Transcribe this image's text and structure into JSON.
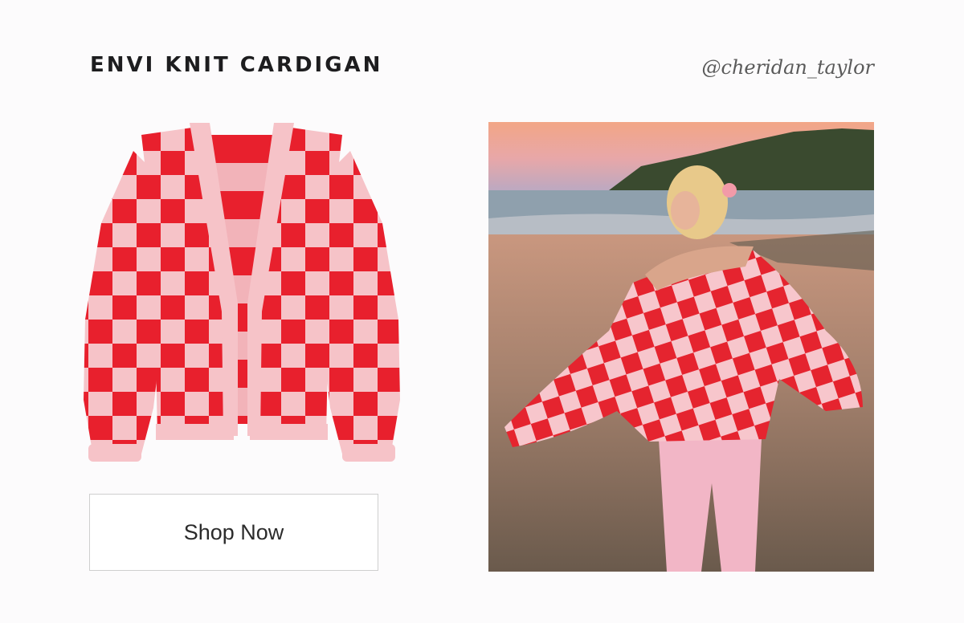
{
  "header": {
    "title": "ENVI KNIT CARDIGAN",
    "handle": "@cheridan_taylor"
  },
  "cta": {
    "label": "Shop Now"
  },
  "colors": {
    "background": "#fcfbfc",
    "knit_red": "#e8202d",
    "knit_pink": "#f6c3c8",
    "text_dark": "#1d1d1f"
  }
}
